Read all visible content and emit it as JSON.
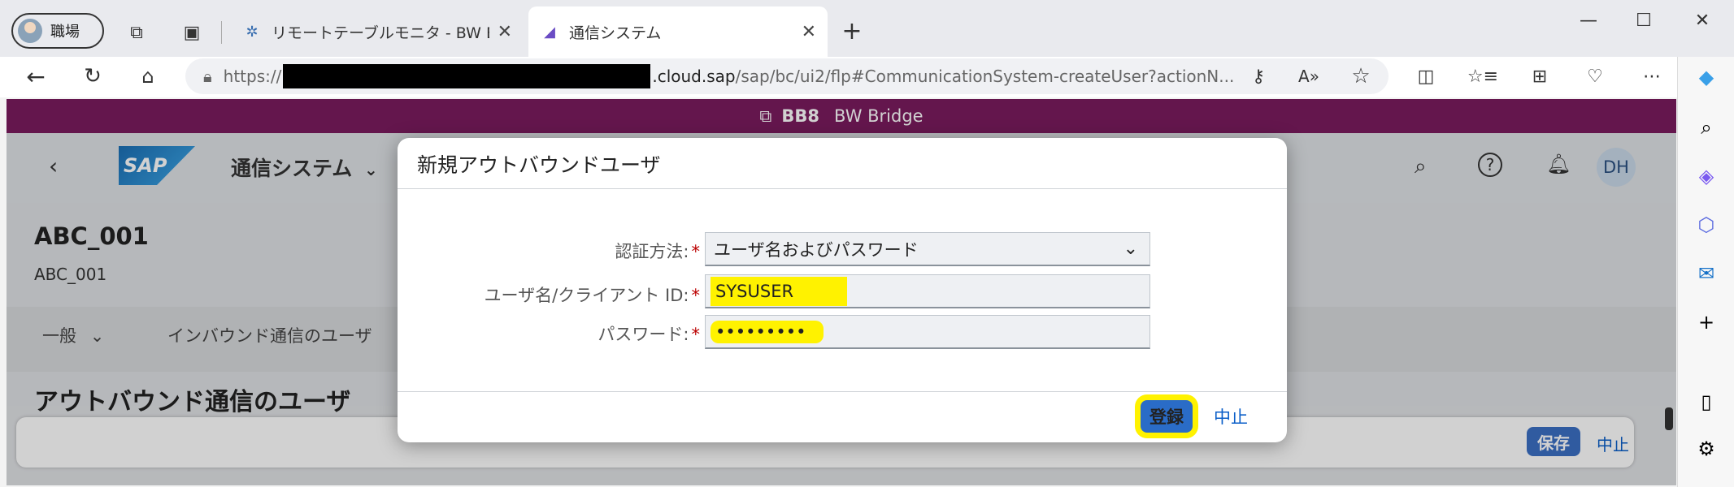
{
  "browser": {
    "profile_name": "職場",
    "tabs": [
      {
        "title": "リモートテーブルモニタ - BW Bridge (S",
        "active": false
      },
      {
        "title": "通信システム",
        "active": true
      }
    ],
    "url": {
      "prefix": "https://",
      "host_visible": ".cloud.sap",
      "path": "/sap/bc/ui2/flp#CommunicationSystem-createUser?actionN..."
    }
  },
  "system_bar": {
    "code": "BB8",
    "name": "BW Bridge"
  },
  "shell": {
    "app_title": "通信システム",
    "user_initials": "DH"
  },
  "object_header": {
    "title": "ABC_001",
    "subtitle": "ABC_001"
  },
  "section_tabs": [
    "一般",
    "インバウンド通信のユーザ"
  ],
  "section_title": "アウトバウンド通信のユーザ",
  "footer": {
    "save_label": "保存",
    "cancel_label": "中止"
  },
  "dialog": {
    "title": "新規アウトバウンドユーザ",
    "auth_method_label": "認証方法:",
    "auth_method_value": "ユーザ名およびパスワード",
    "username_label": "ユーザ名/クライアント ID:",
    "username_value": "SYSUSER",
    "password_label": "パスワード:",
    "password_value": "•••••••••",
    "register_label": "登録",
    "cancel_label": "中止"
  },
  "colors": {
    "system_bar": "#7b1b5e",
    "highlight": "#fff200",
    "accent": "#2a6cc7"
  }
}
